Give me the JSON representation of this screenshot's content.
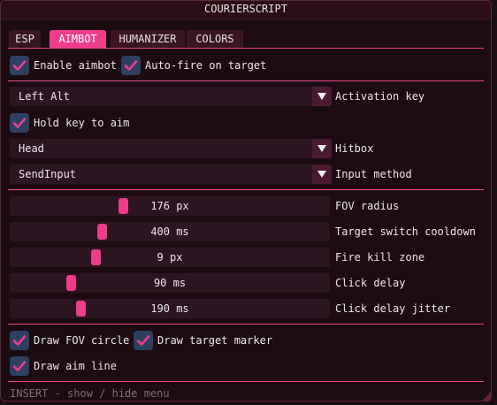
{
  "window": {
    "title": "COURIERSCRIPT"
  },
  "tabs": [
    {
      "label": "ESP",
      "active": false
    },
    {
      "label": "AIMBOT",
      "active": true
    },
    {
      "label": "HUMANIZER",
      "active": false
    },
    {
      "label": "COLORS",
      "active": false
    }
  ],
  "checks": {
    "enable_aimbot": {
      "label": "Enable aimbot",
      "checked": true
    },
    "auto_fire": {
      "label": "Auto-fire on target",
      "checked": true
    },
    "hold_key": {
      "label": "Hold key to aim",
      "checked": true
    },
    "draw_fov": {
      "label": "Draw FOV circle",
      "checked": true
    },
    "draw_target": {
      "label": "Draw target marker",
      "checked": true
    },
    "draw_aim_line": {
      "label": "Draw aim line",
      "checked": true
    }
  },
  "combos": {
    "activation_key": {
      "value": "Left Alt",
      "label": "Activation key"
    },
    "hitbox": {
      "value": "Head",
      "label": "Hitbox"
    },
    "input_method": {
      "value": "SendInput",
      "label": "Input method"
    }
  },
  "sliders": {
    "fov_radius": {
      "display": "176 px",
      "label": "FOV radius",
      "fraction": 0.35
    },
    "target_switch": {
      "display": "400 ms",
      "label": "Target switch cooldown",
      "fraction": 0.28
    },
    "fire_kill_zone": {
      "display": "9 px",
      "label": "Fire kill zone",
      "fraction": 0.26
    },
    "click_delay": {
      "display": "90 ms",
      "label": "Click delay",
      "fraction": 0.18
    },
    "click_delay_jitter": {
      "display": "190 ms",
      "label": "Click delay jitter",
      "fraction": 0.21
    }
  },
  "footer": {
    "hint": "INSERT - show / hide menu"
  },
  "colors": {
    "accent": "#ee3d8a",
    "checkbox": "#2d4060",
    "frame": "#2c1520"
  },
  "icons": {
    "check": "checkmark-icon",
    "dropdown": "triangle-down-icon"
  }
}
